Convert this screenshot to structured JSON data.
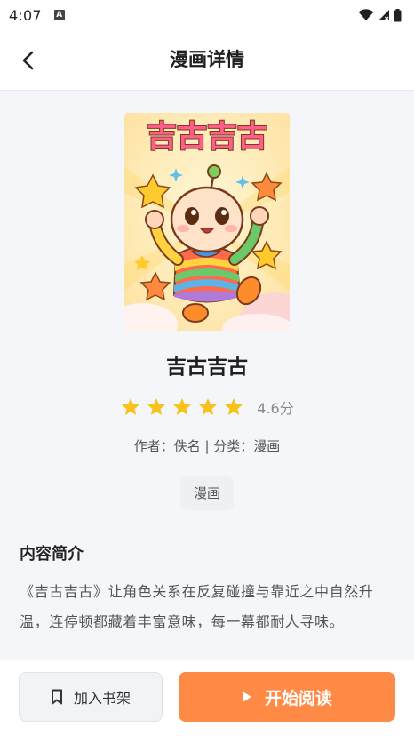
{
  "status_bar": {
    "time": "4:07",
    "a_badge": "A"
  },
  "header": {
    "title": "漫画详情",
    "back_icon": "chevron-left-icon"
  },
  "comic": {
    "title": "吉古吉古",
    "cover_title": "吉古吉古",
    "rating": 4.6,
    "rating_text": "4.6分",
    "stars_filled": 5,
    "meta": "作者：佚名 | 分类：漫画",
    "tag": "漫画"
  },
  "description": {
    "heading": "内容简介",
    "text": "《吉古吉古》让角色关系在反复碰撞与靠近之中自然升温，连停顿都藏着丰富意味，每一幕都耐人寻味。"
  },
  "actions": {
    "shelf_label": "加入书架",
    "shelf_icon": "bookmark-icon",
    "read_label": "开始阅读",
    "read_icon": "play-icon"
  },
  "colors": {
    "accent": "#ff8a45",
    "star": "#f8c21c"
  }
}
